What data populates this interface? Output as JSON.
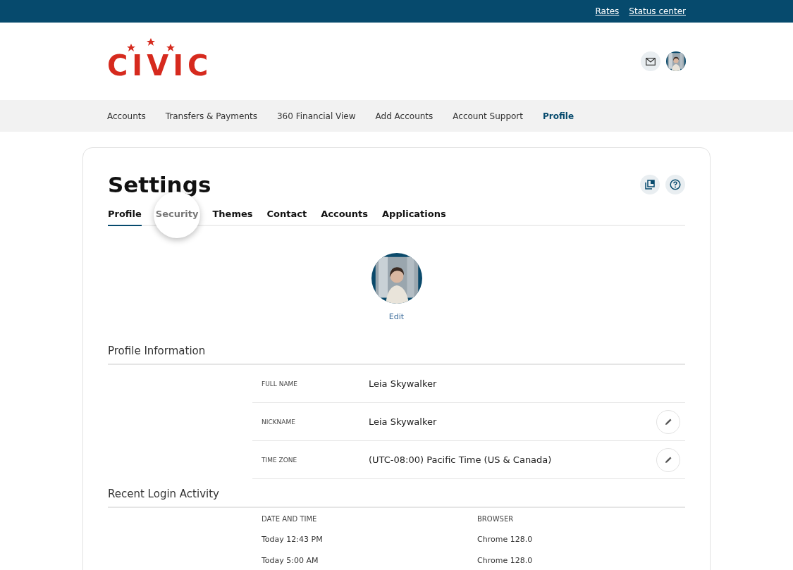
{
  "top_links": [
    "Rates",
    "Status center"
  ],
  "logo": "CIVIC",
  "nav": [
    {
      "label": "Accounts",
      "selected": false
    },
    {
      "label": "Transfers & Payments",
      "selected": false
    },
    {
      "label": "360 Financial View",
      "selected": false
    },
    {
      "label": "Add Accounts",
      "selected": false
    },
    {
      "label": "Account Support",
      "selected": false
    },
    {
      "label": "Profile",
      "selected": true
    }
  ],
  "title": "Settings",
  "tabs": [
    {
      "label": "Profile",
      "selected": true,
      "spotlight": false
    },
    {
      "label": "Security",
      "selected": false,
      "spotlight": true
    },
    {
      "label": "Themes",
      "selected": false,
      "spotlight": false
    },
    {
      "label": "Contact",
      "selected": false,
      "spotlight": false
    },
    {
      "label": "Accounts",
      "selected": false,
      "spotlight": false
    },
    {
      "label": "Applications",
      "selected": false,
      "spotlight": false
    }
  ],
  "avatar_link": "Edit",
  "profile_section": {
    "heading": "Profile Information",
    "fields": [
      {
        "label": "FULL NAME",
        "value": "Leia Skywalker",
        "editable": false
      },
      {
        "label": "NICKNAME",
        "value": "Leia Skywalker",
        "editable": true
      },
      {
        "label": "TIME ZONE",
        "value": "(UTC-08:00) Pacific Time (US & Canada)",
        "editable": true
      }
    ]
  },
  "login_section": {
    "heading": "Recent Login Activity",
    "columns": [
      "DATE AND TIME",
      "BROWSER"
    ],
    "rows": [
      [
        "Today 12:43 PM",
        "Chrome 128.0"
      ],
      [
        "Today 5:00 AM",
        "Chrome 128.0"
      ]
    ]
  }
}
